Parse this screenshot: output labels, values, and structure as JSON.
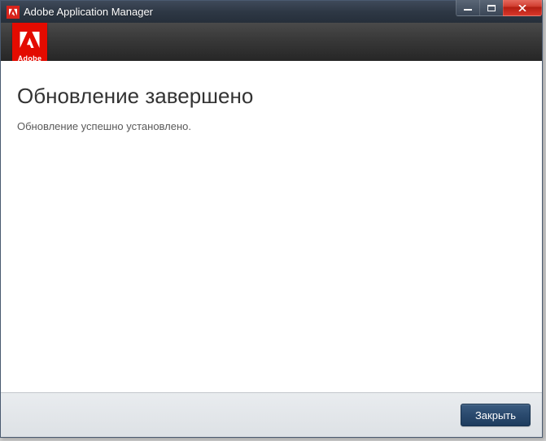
{
  "window": {
    "title": "Adobe Application Manager"
  },
  "branding": {
    "name": "Adobe",
    "accent": "#e30b00"
  },
  "main": {
    "heading": "Обновление завершено",
    "message": "Обновление успешно установлено."
  },
  "footer": {
    "close_label": "Закрыть"
  }
}
